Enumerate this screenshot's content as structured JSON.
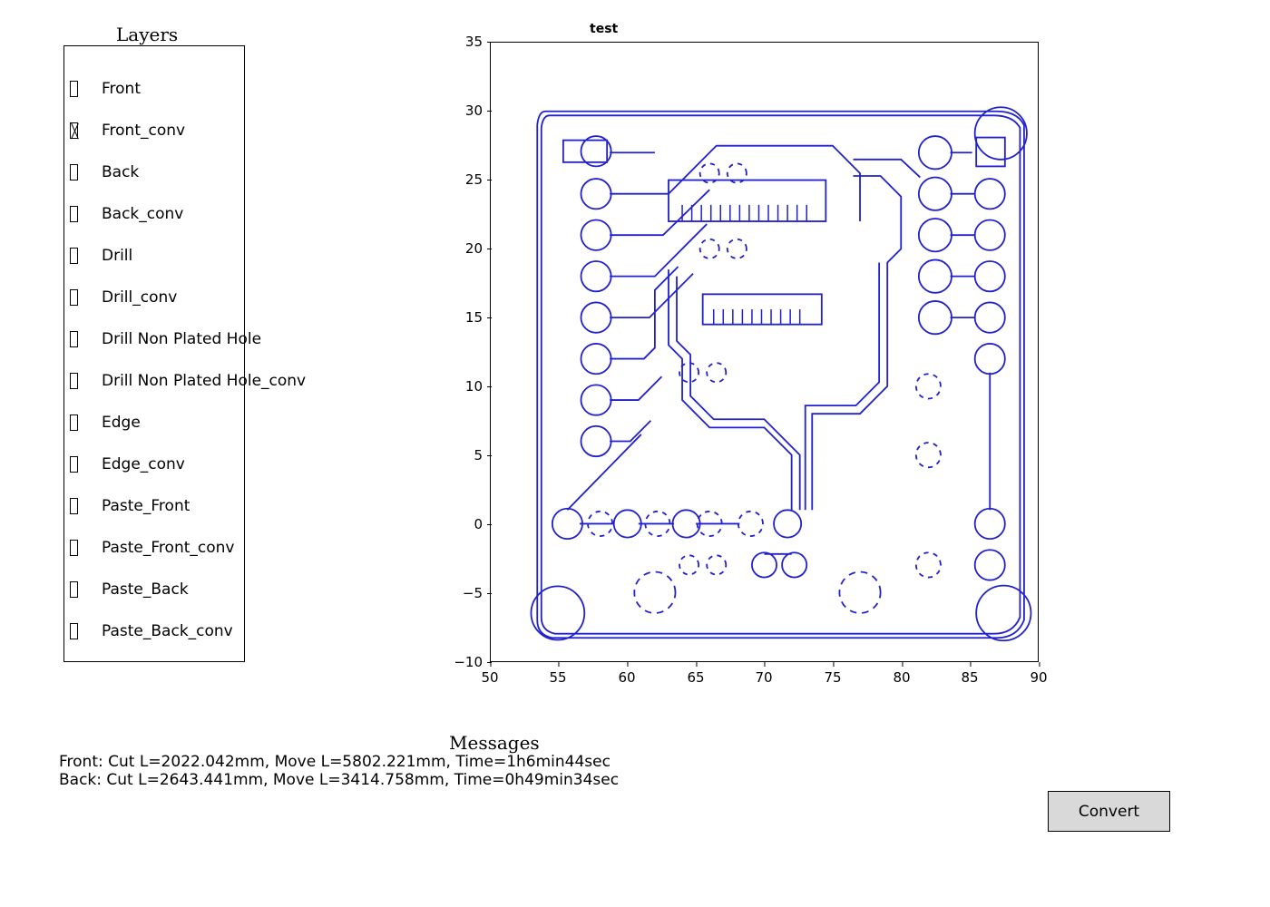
{
  "layers": {
    "title": "Layers",
    "items": [
      {
        "label": "Front",
        "checked": false
      },
      {
        "label": "Front_conv",
        "checked": true
      },
      {
        "label": "Back",
        "checked": false
      },
      {
        "label": "Back_conv",
        "checked": false
      },
      {
        "label": "Drill",
        "checked": false
      },
      {
        "label": "Drill_conv",
        "checked": false
      },
      {
        "label": "Drill Non Plated Hole",
        "checked": false
      },
      {
        "label": "Drill Non Plated Hole_conv",
        "checked": false
      },
      {
        "label": "Edge",
        "checked": false
      },
      {
        "label": "Edge_conv",
        "checked": false
      },
      {
        "label": "Paste_Front",
        "checked": false
      },
      {
        "label": "Paste_Front_conv",
        "checked": false
      },
      {
        "label": "Paste_Back",
        "checked": false
      },
      {
        "label": "Paste_Back_conv",
        "checked": false
      }
    ]
  },
  "plot": {
    "title": "test",
    "x_ticks": [
      "50",
      "55",
      "60",
      "65",
      "70",
      "75",
      "80",
      "85",
      "90"
    ],
    "y_ticks": [
      "35",
      "30",
      "25",
      "20",
      "15",
      "10",
      "5",
      "0",
      "−5",
      "−10"
    ],
    "stroke": "#2222cc"
  },
  "messages": {
    "title": "Messages",
    "lines": [
      "Front: Cut L=2022.042mm, Move L=5802.221mm, Time=1h6min44sec",
      "Back: Cut L=2643.441mm, Move L=3414.758mm, Time=0h49min34sec"
    ]
  },
  "buttons": {
    "convert": "Convert"
  }
}
